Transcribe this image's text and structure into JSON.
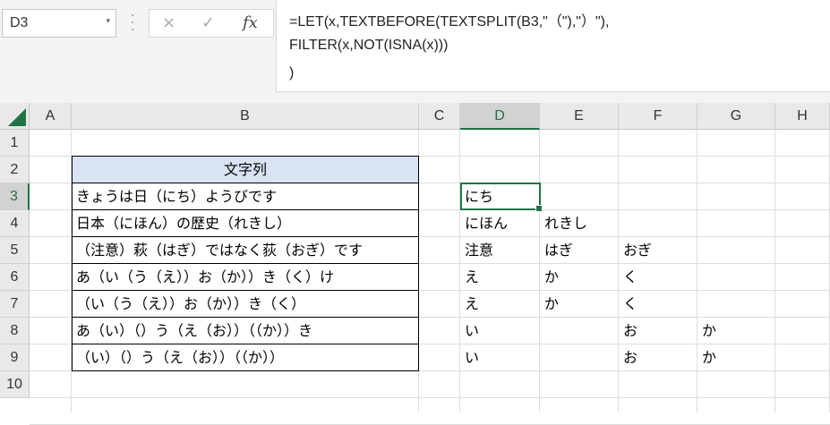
{
  "name_box": {
    "value": "D3"
  },
  "formula_bar": {
    "lines": [
      "=LET(x,TEXTBEFORE(TEXTSPLIT(B3,\"（\"),\"）\"),",
      "FILTER(x,NOT(ISNA(x)))",
      ")"
    ]
  },
  "icons": {
    "cancel": "×",
    "enter": "✓",
    "fx": "fx",
    "dropdown": "▾"
  },
  "columns": [
    "A",
    "B",
    "C",
    "D",
    "E",
    "F",
    "G",
    "H"
  ],
  "rows": [
    "1",
    "2",
    "3",
    "4",
    "5",
    "6",
    "7",
    "8",
    "9",
    "10"
  ],
  "selected": {
    "column": "D",
    "row": "3"
  },
  "accent_color": "#217346",
  "header_fill": "#dae3f3",
  "col_b": {
    "header": "文字列",
    "values": [
      "きょうは日（にち）ようびです",
      "日本（にほん）の歴史（れきし）",
      "（注意）萩（はぎ）ではなく荻（おぎ）です",
      "あ（い（う（え））お（か））き（く）け",
      "（い（う（え））お（か））き（く）",
      "あ（い）（）う（え（お））（（か））き",
      "（い）（）う（え（お））（（か））"
    ]
  },
  "results": [
    [
      "にち",
      "",
      "",
      ""
    ],
    [
      "にほん",
      "れきし",
      "",
      ""
    ],
    [
      "注意",
      "はぎ",
      "おぎ",
      ""
    ],
    [
      "え",
      "か",
      "く",
      ""
    ],
    [
      "え",
      "か",
      "く",
      ""
    ],
    [
      "い",
      "",
      "お",
      "か"
    ],
    [
      "い",
      "",
      "お",
      "か"
    ]
  ]
}
